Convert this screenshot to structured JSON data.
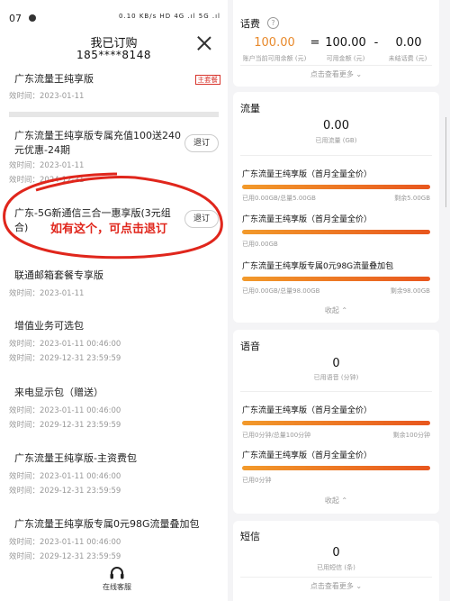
{
  "status_bar": {
    "time": "07",
    "icons": "0.10 KB/s  HD  4G  .ıl  5G .ıl"
  },
  "header": {
    "title": "我已订购",
    "phone": "185****8148"
  },
  "items": [
    {
      "name": "广东流量王纯享版",
      "date1": "效时间：2023-01-11",
      "tag": "主套餐"
    },
    {
      "name": "广东流量王纯享版专属充值100送240元优惠-24期",
      "date1": "效时间：2023-01-11",
      "date2": "效时间：2024-12-31",
      "button": "退订"
    },
    {
      "name": "广东-5G新通信三合一惠享版(3元组合)",
      "button": "退订"
    },
    {
      "name": "联通邮箱套餐专享版",
      "date1": "效时间：2023-01-11"
    },
    {
      "name": "增值业务可选包",
      "date1": "效时间：2023-01-11 00:46:00",
      "date2": "效时间：2029-12-31 23:59:59"
    },
    {
      "name": "来电显示包（赠送）",
      "date1": "效时间：2023-01-11 00:46:00",
      "date2": "效时间：2029-12-31 23:59:59"
    },
    {
      "name": "广东流量王纯享版-主资费包",
      "date1": "效时间：2023-01-11 00:46:00",
      "date2": "效时间：2029-12-31 23:59:59"
    },
    {
      "name": "广东流量王纯享版专属0元98G流量叠加包",
      "date1": "效时间：2023-01-11 00:46:00",
      "date2": "效时间：2029-12-31 23:59:59"
    }
  ],
  "annotation": "如有这个，可点击退订",
  "customer_service": "在线客服",
  "fee": {
    "title": "话费",
    "balance": "100.00",
    "balance_label": "账户当前可用余额 (元)",
    "op_eq": "=",
    "available": "100.00",
    "available_label": "可用金额 (元)",
    "op_minus": "-",
    "unpaid": "0.00",
    "unpaid_label": "未结话费 (元)",
    "more": "点击查看更多"
  },
  "traffic": {
    "title": "流量",
    "used": "0.00",
    "used_label": "已用流量 (GB)",
    "packages": [
      {
        "name": "广东流量王纯享版（首月全量全价）",
        "left": "已用0.00GB/总量5.00GB",
        "right": "剩余5.00GB"
      },
      {
        "name": "广东流量王纯享版（首月全量全价）",
        "left": "已用0.00GB",
        "right": ""
      },
      {
        "name": "广东流量王纯享版专属0元98G流量叠加包",
        "left": "已用0.00GB/总量98.00GB",
        "right": "剩余98.00GB"
      }
    ],
    "collapse": "收起"
  },
  "voice": {
    "title": "语音",
    "used": "0",
    "used_label": "已用语音 (分钟)",
    "packages": [
      {
        "name": "广东流量王纯享版（首月全量全价）",
        "left": "已用0分钟/总量100分钟",
        "right": "剩余100分钟"
      },
      {
        "name": "广东流量王纯享版（首月全量全价）",
        "left": "已用0分钟",
        "right": ""
      }
    ],
    "collapse": "收起"
  },
  "sms": {
    "title": "短信",
    "used": "0",
    "used_label": "已用短信 (条)",
    "more": "点击查看更多"
  }
}
